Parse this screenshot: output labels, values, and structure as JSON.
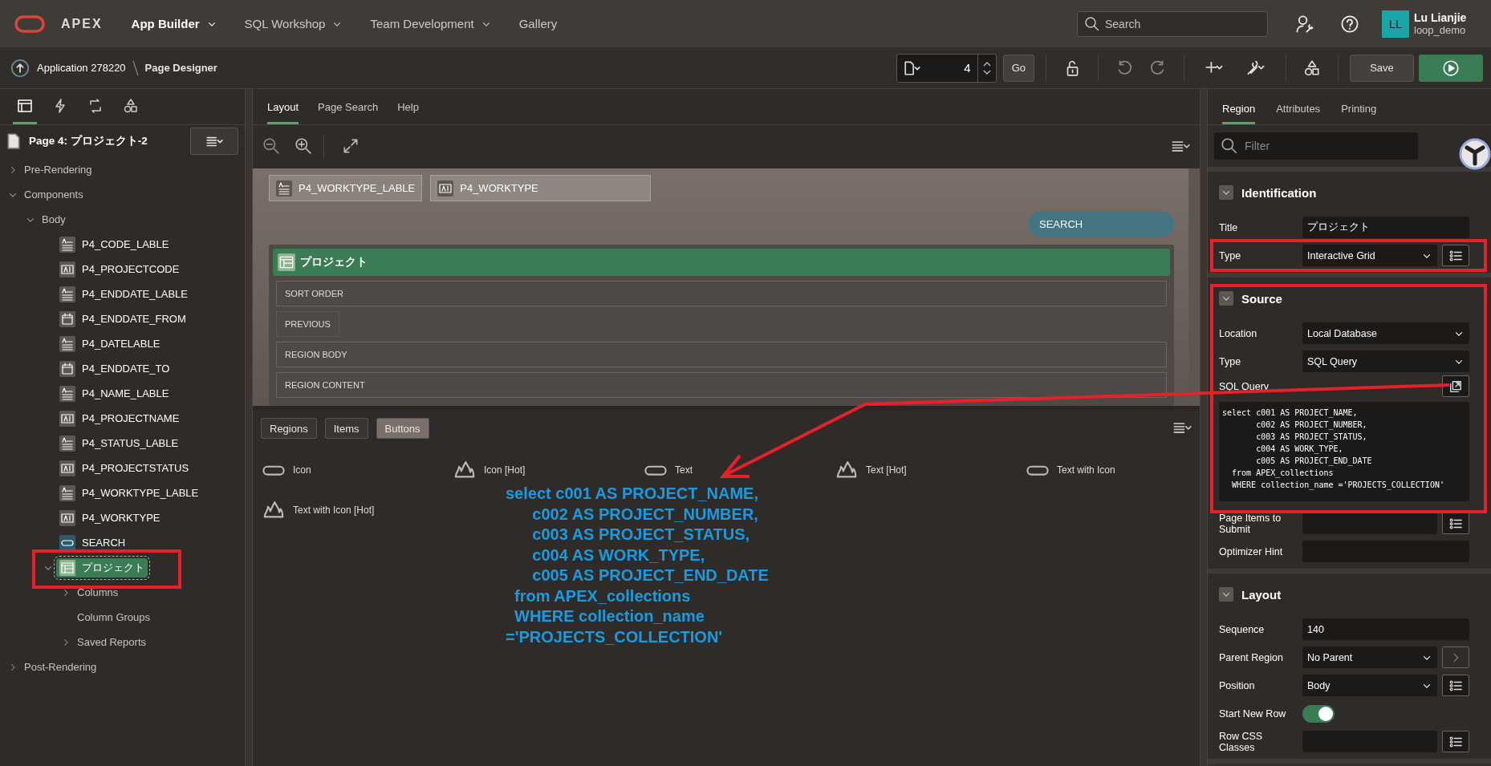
{
  "header": {
    "logo": "APEX",
    "nav": [
      {
        "label": "App Builder",
        "selected": true,
        "menu": true
      },
      {
        "label": "SQL Workshop",
        "selected": false,
        "menu": true
      },
      {
        "label": "Team Development",
        "selected": false,
        "menu": true
      },
      {
        "label": "Gallery",
        "selected": false,
        "menu": false
      }
    ],
    "search": {
      "placeholder": "Search"
    },
    "user": {
      "initials": "LL",
      "name": "Lu Lianjie",
      "workspace": "loop_demo"
    }
  },
  "toolbar": {
    "breadcrumb": [
      "Application 278220",
      "Page Designer"
    ],
    "page_number": "4",
    "go": "Go",
    "save": "Save"
  },
  "left_panel": {
    "tabs": [
      {
        "selected": true
      },
      {
        "selected": false
      },
      {
        "selected": false
      },
      {
        "selected": false
      }
    ],
    "page_title": "Page 4: プロジェクト-2",
    "tree": [
      {
        "label": "Pre-Rendering",
        "expanded": false,
        "selected": false
      },
      {
        "label": "Components",
        "expanded": true,
        "selected": false,
        "children": [
          {
            "label": "Body",
            "expanded": true,
            "selected": false,
            "children": [
              {
                "label": "P4_CODE_LABLE",
                "kind": "label",
                "selected": false
              },
              {
                "label": "P4_PROJECTCODE",
                "kind": "text",
                "selected": false
              },
              {
                "label": "P4_ENDDATE_LABLE",
                "kind": "label",
                "selected": false
              },
              {
                "label": "P4_ENDDATE_FROM",
                "kind": "date",
                "selected": false
              },
              {
                "label": "P4_DATELABLE",
                "kind": "label",
                "selected": false
              },
              {
                "label": "P4_ENDDATE_TO",
                "kind": "date",
                "selected": false
              },
              {
                "label": "P4_NAME_LABLE",
                "kind": "label",
                "selected": false
              },
              {
                "label": "P4_PROJECTNAME",
                "kind": "text",
                "selected": false
              },
              {
                "label": "P4_STATUS_LABLE",
                "kind": "label",
                "selected": false
              },
              {
                "label": "P4_PROJECTSTATUS",
                "kind": "text",
                "selected": false
              },
              {
                "label": "P4_WORKTYPE_LABLE",
                "kind": "label",
                "selected": false
              },
              {
                "label": "P4_WORKTYPE",
                "kind": "text",
                "selected": false
              },
              {
                "label": "SEARCH",
                "kind": "button",
                "selected": false
              },
              {
                "label": "プロジェクト",
                "kind": "region",
                "expanded": true,
                "selected": true,
                "children": [
                  {
                    "label": "Columns",
                    "expanded": false,
                    "selected": false
                  },
                  {
                    "label": "Column Groups",
                    "selected": false
                  },
                  {
                    "label": "Saved Reports",
                    "expanded": false,
                    "selected": false
                  }
                ]
              }
            ]
          }
        ]
      },
      {
        "label": "Post-Rendering",
        "expanded": false,
        "selected": false
      }
    ]
  },
  "center": {
    "tabs": [
      {
        "label": "Layout",
        "selected": true
      },
      {
        "label": "Page Search",
        "selected": false
      },
      {
        "label": "Help",
        "selected": false
      }
    ],
    "canvas": {
      "items": [
        {
          "label": "P4_WORKTYPE_LABLE",
          "kind": "label"
        },
        {
          "label": "P4_WORKTYPE",
          "kind": "text"
        }
      ],
      "button": "SEARCH",
      "region": {
        "title": "プロジェクト",
        "slots": [
          {
            "label": "SORT ORDER",
            "kind": "wide"
          },
          {
            "label": "PREVIOUS",
            "kind": "narrow"
          },
          {
            "label": "REGION BODY",
            "kind": "wide"
          },
          {
            "label": "REGION CONTENT",
            "kind": "wide"
          }
        ]
      }
    },
    "gallery": {
      "tabs": [
        {
          "label": "Regions",
          "selected": false
        },
        {
          "label": "Items",
          "selected": false
        },
        {
          "label": "Buttons",
          "selected": true
        }
      ],
      "items": [
        {
          "label": "Icon",
          "kind": "pill"
        },
        {
          "label": "Icon [Hot]",
          "kind": "hot"
        },
        {
          "label": "Text",
          "kind": "pill"
        },
        {
          "label": "Text [Hot]",
          "kind": "hot"
        },
        {
          "label": "Text with Icon",
          "kind": "pill"
        },
        {
          "label": "Text with Icon [Hot]",
          "kind": "hot"
        }
      ]
    }
  },
  "right_panel": {
    "tabs": [
      {
        "label": "Region",
        "selected": true
      },
      {
        "label": "Attributes",
        "selected": false
      },
      {
        "label": "Printing",
        "selected": false
      }
    ],
    "filter": {
      "placeholder": "Filter"
    },
    "sections": [
      {
        "title": "Identification",
        "expanded": true,
        "rows": [
          {
            "label": "Title",
            "kind": "text",
            "value": "プロジェクト"
          },
          {
            "label": "Type",
            "kind": "select_list",
            "value": "Interactive Grid"
          }
        ]
      },
      {
        "title": "Source",
        "expanded": true,
        "rows": [
          {
            "label": "Location",
            "kind": "select",
            "value": "Local Database"
          },
          {
            "label": "Type",
            "kind": "select",
            "value": "SQL Query"
          },
          {
            "label": "SQL Query",
            "kind": "code_popout",
            "value": "select c001 AS PROJECT_NAME,\n       c002 AS PROJECT_NUMBER,\n       c003 AS PROJECT_STATUS,\n       c004 AS WORK_TYPE,\n       c005 AS PROJECT_END_DATE\n  from APEX_collections\n  WHERE collection_name ='PROJECTS_COLLECTION'"
          },
          {
            "label": "Page Items to Submit",
            "kind": "text_list"
          },
          {
            "label": "Optimizer Hint",
            "kind": "text"
          }
        ]
      },
      {
        "title": "Layout",
        "expanded": true,
        "rows": [
          {
            "label": "Sequence",
            "kind": "text",
            "value": "140"
          },
          {
            "label": "Parent Region",
            "kind": "select_next",
            "value": "No Parent"
          },
          {
            "label": "Position",
            "kind": "select_list",
            "value": "Body"
          },
          {
            "label": "Start New Row",
            "kind": "toggle",
            "on": true
          },
          {
            "label": "Row CSS Classes",
            "kind": "text_list"
          }
        ]
      }
    ]
  },
  "annotation": {
    "text": "select c001 AS PROJECT_NAME,\n      c002 AS PROJECT_NUMBER,\n      c003 AS PROJECT_STATUS,\n      c004 AS WORK_TYPE,\n      c005 AS PROJECT_END_DATE\n  from APEX_collections\n  WHERE collection_name\n='PROJECTS_COLLECTION'"
  }
}
